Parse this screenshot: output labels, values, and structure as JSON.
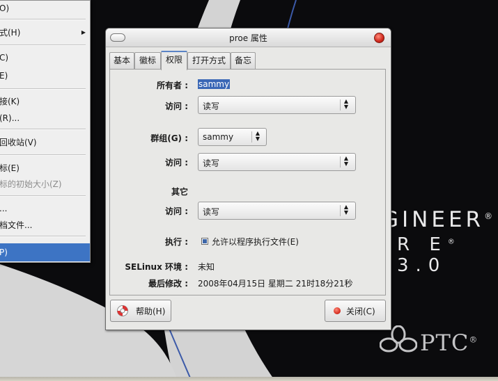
{
  "context_menu": {
    "items": [
      {
        "label": "O)"
      },
      {
        "label": "式(H)",
        "submenu": true
      },
      {
        "label": "C)"
      },
      {
        "label": "E)"
      },
      {
        "label": "接(K)"
      },
      {
        "label": "(R)..."
      },
      {
        "label": "回收站(V)"
      },
      {
        "label": "标(E)"
      },
      {
        "label": "标的初始大小(Z)",
        "disabled": true
      },
      {
        "label": "..."
      },
      {
        "label": "档文件..."
      },
      {
        "label": "P)",
        "selected": true
      }
    ]
  },
  "dialog": {
    "title": "proe 属性",
    "tabs": [
      "基本",
      "徽标",
      "权限",
      "打开方式",
      "备忘"
    ],
    "active_tab": "权限",
    "owner": {
      "label": "所有者 :",
      "value": "sammy"
    },
    "owner_access": {
      "label": "访问 :",
      "value": "读写"
    },
    "group": {
      "label": "群组(G) :",
      "value": "sammy"
    },
    "group_access": {
      "label": "访问 :",
      "value": "读写"
    },
    "others": {
      "label": "其它"
    },
    "others_access": {
      "label": "访问 :",
      "value": "读写"
    },
    "execute": {
      "label": "执行 :",
      "checkbox_label": "允许以程序执行文件(E)",
      "checked": true
    },
    "selinux": {
      "label": "SELinux 环境 :",
      "value": "未知"
    },
    "modified": {
      "label": "最后修改 :",
      "value": "2008年04月15日 星期二 21时18分21秒"
    },
    "help_button": "帮助(H)",
    "close_button": "关闭(C)"
  },
  "background": {
    "brand_line1": "GINEER",
    "brand_line2": "R E",
    "brand_version": "3.0",
    "reg_mark": "®",
    "ptc_logo": "PTC"
  },
  "colors": {
    "selection": "#3d74c4",
    "close_red": "#d0281d",
    "desktop": "#0b0b0d"
  }
}
